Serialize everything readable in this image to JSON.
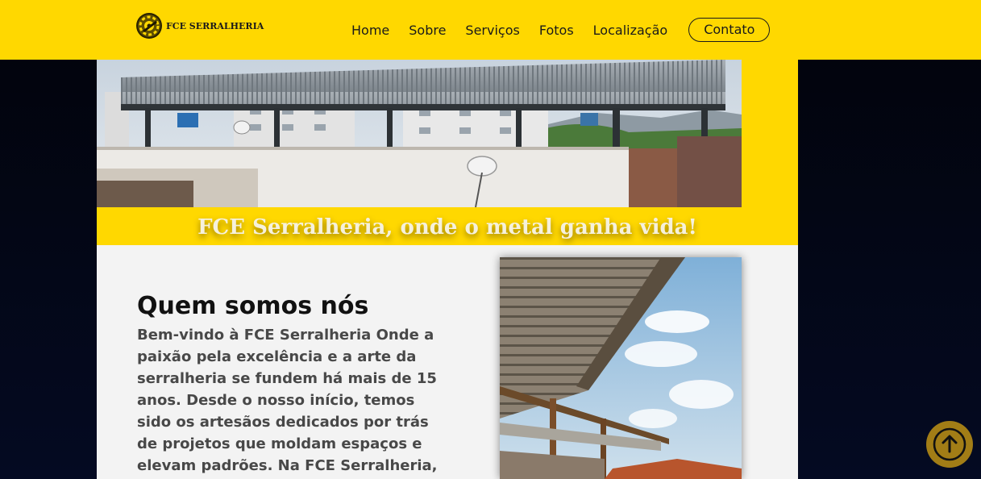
{
  "header": {
    "logo_text": "FCE SERRALHERIA",
    "nav": {
      "home": "Home",
      "sobre": "Sobre",
      "servicos": "Serviços",
      "fotos": "Fotos",
      "localizacao": "Localização",
      "contato": "Contato"
    }
  },
  "hero": {
    "slogan": "FCE Serralheria, onde o metal ganha vida!"
  },
  "about": {
    "title": "Quem somos nós",
    "text": "Bem-vindo à FCE Serralheria Onde a paixão pela excelência e a arte da serralheria se fundem há mais de 15 anos. Desde o nosso início, temos sido os artesãos dedicados por trás de projetos que moldam espaços e elevam padrões. Na FCE Serralheria,"
  },
  "icons": {
    "logo": "gear-logo-icon",
    "back_to_top": "arrow-up-circle-icon"
  },
  "colors": {
    "accent_yellow": "#ffd800",
    "back_to_top": "#a27d16",
    "about_bg": "#f3f3f3",
    "page_bg": "#040a22"
  }
}
